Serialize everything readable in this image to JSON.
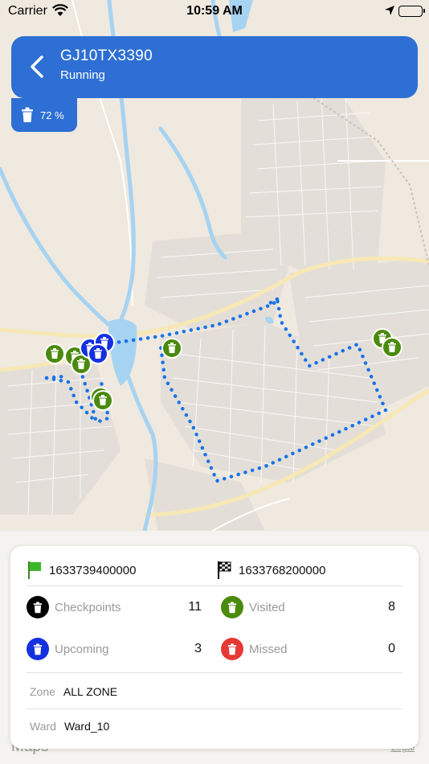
{
  "status_bar": {
    "carrier": "Carrier",
    "time": "10:59 AM"
  },
  "header": {
    "vehicle_number": "GJ10TX3390",
    "status": "Running"
  },
  "fill_level": {
    "text": "72 %",
    "value_percent": 72
  },
  "map": {
    "colors": {
      "route": "#1a73e8",
      "visited": "#4a8a0c",
      "upcoming": "#1530e0",
      "missed": "#e53935",
      "checkpoint": "#000000"
    },
    "credit_brand": "Maps",
    "credit_legal": "Legal"
  },
  "summary": {
    "start_time": "1633739400000",
    "end_time": "1633768200000",
    "checkpoints": {
      "label": "Checkpoints",
      "value": "11"
    },
    "visited": {
      "label": "Visited",
      "value": "8"
    },
    "upcoming": {
      "label": "Upcoming",
      "value": "3"
    },
    "missed": {
      "label": "Missed",
      "value": "0"
    },
    "zone": {
      "label": "Zone",
      "value": "ALL ZONE"
    },
    "ward": {
      "label": "Ward",
      "value": "Ward_10"
    }
  }
}
